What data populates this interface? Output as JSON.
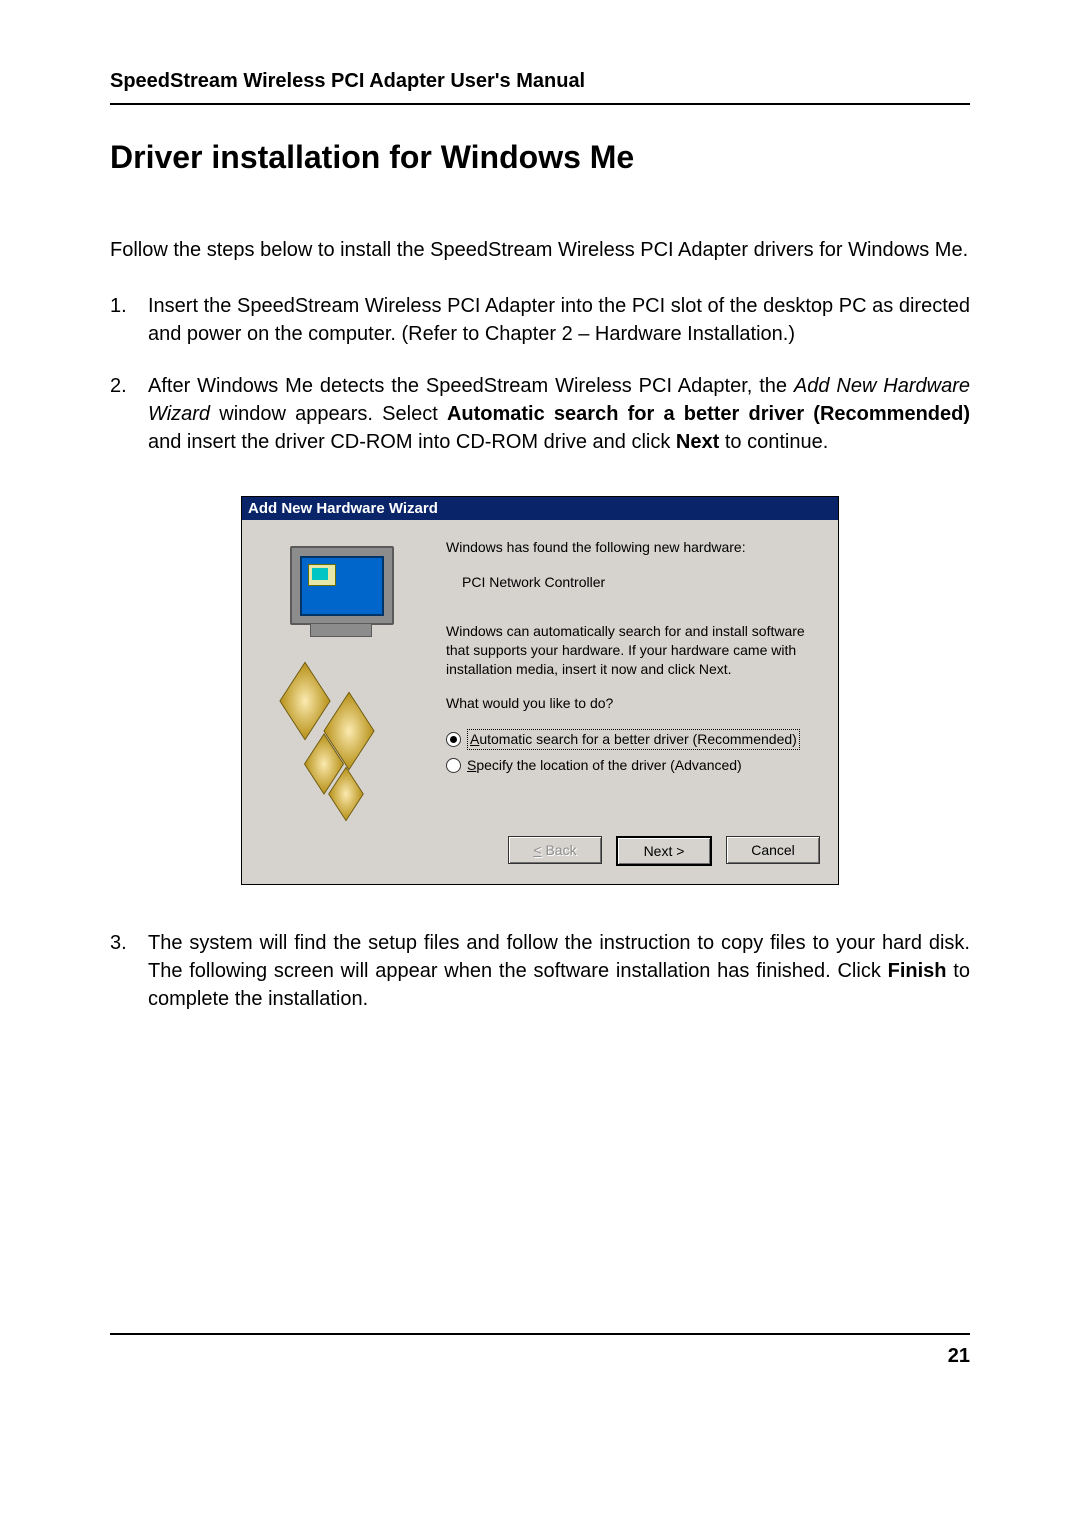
{
  "header": "SpeedStream Wireless PCI Adapter User's Manual",
  "title": "Driver installation for Windows Me",
  "intro": "Follow the steps below to install the SpeedStream Wireless PCI Adapter drivers for Windows Me.",
  "steps": {
    "s1": "Insert the SpeedStream Wireless PCI Adapter into the PCI slot of the desktop PC as directed and power on the computer. (Refer to Chapter 2 – Hardware Installation.)",
    "s2_a": "After Windows Me detects the SpeedStream Wireless PCI Adapter, the ",
    "s2_italic": "Add New Hardware Wizard",
    "s2_b": " window appears. Select ",
    "s2_bold1": "Automatic search for a better driver (Recommended)",
    "s2_c": " and insert the driver CD-ROM into CD-ROM drive and click ",
    "s2_bold2": "Next",
    "s2_d": " to continue.",
    "s3_a": "The system will find the setup files and follow the instruction to copy files to your hard disk. The following screen will appear when the software installation has finished. Click ",
    "s3_bold": "Finish",
    "s3_b": " to complete the installation."
  },
  "dialog": {
    "title": "Add New Hardware Wizard",
    "found_label": "Windows has found the following new hardware:",
    "device": "PCI Network Controller",
    "desc": "Windows can automatically search for and install software that supports your hardware. If your hardware came with installation media, insert it now and click Next.",
    "question": "What would you like to do?",
    "opt1": "Automatic search for a better driver (Recommended)",
    "opt2": "Specify the location of the driver (Advanced)",
    "back": "< Back",
    "next": "Next >",
    "cancel": "Cancel"
  },
  "page_number": "21"
}
